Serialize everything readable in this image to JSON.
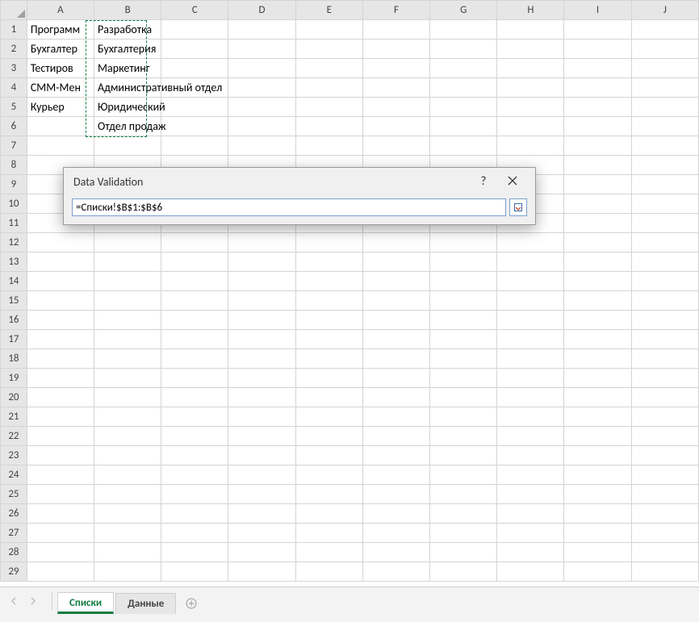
{
  "columns": [
    "A",
    "B",
    "C",
    "D",
    "E",
    "F",
    "G",
    "H",
    "I",
    "J"
  ],
  "rows": [
    "1",
    "2",
    "3",
    "4",
    "5",
    "6",
    "7",
    "8",
    "9",
    "10",
    "11",
    "12",
    "13",
    "14",
    "15",
    "16",
    "17",
    "18",
    "19",
    "20",
    "21",
    "22",
    "23",
    "24",
    "25",
    "26",
    "27",
    "28",
    "29"
  ],
  "cells": {
    "A1": "Программ",
    "A2": "Бухгалтер",
    "A3": "Тестиров",
    "A4": "СММ-Мен",
    "A5": "Курьер",
    "B1": "Разработка",
    "B2": "Бухгалтерия",
    "B3": "Маркетинг",
    "B4": "Административный отдел",
    "B5": "Юридический",
    "B6": "Отдел продаж"
  },
  "dialog": {
    "title": "Data Validation",
    "help": "?",
    "formula": "=Списки!$B$1:$B$6"
  },
  "tabs": {
    "items": [
      {
        "label": "Списки",
        "active": true
      },
      {
        "label": "Данные",
        "active": false
      }
    ]
  }
}
